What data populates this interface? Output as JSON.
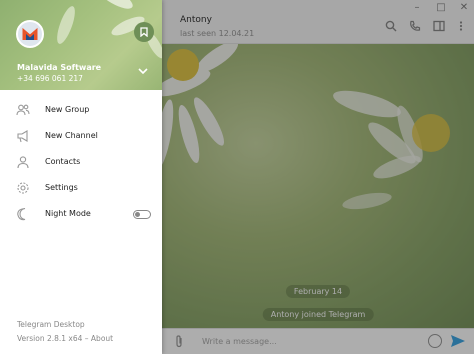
{
  "window": {
    "minimize_glyph": "–",
    "maximize_glyph": "□",
    "close_glyph": "✕"
  },
  "chat": {
    "name": "Antony",
    "status": "last seen 12.04.21",
    "service_date": "February 14",
    "service_message": "Antony joined Telegram",
    "compose_placeholder": "Write a message..."
  },
  "menu": {
    "account_name": "Malavida Software",
    "account_phone": "+34 696 061 217",
    "items": [
      {
        "label": "New Group",
        "icon": "group-icon"
      },
      {
        "label": "New Channel",
        "icon": "megaphone-icon"
      },
      {
        "label": "Contacts",
        "icon": "person-icon"
      },
      {
        "label": "Settings",
        "icon": "gear-icon"
      },
      {
        "label": "Night Mode",
        "icon": "moon-icon",
        "toggle": false
      }
    ],
    "footer_app": "Telegram Desktop",
    "footer_version": "Version 2.8.1 x64 – About"
  },
  "colors": {
    "accent": "#40a7e3",
    "menu_icon": "#999999",
    "cover": "#a4c07e"
  }
}
